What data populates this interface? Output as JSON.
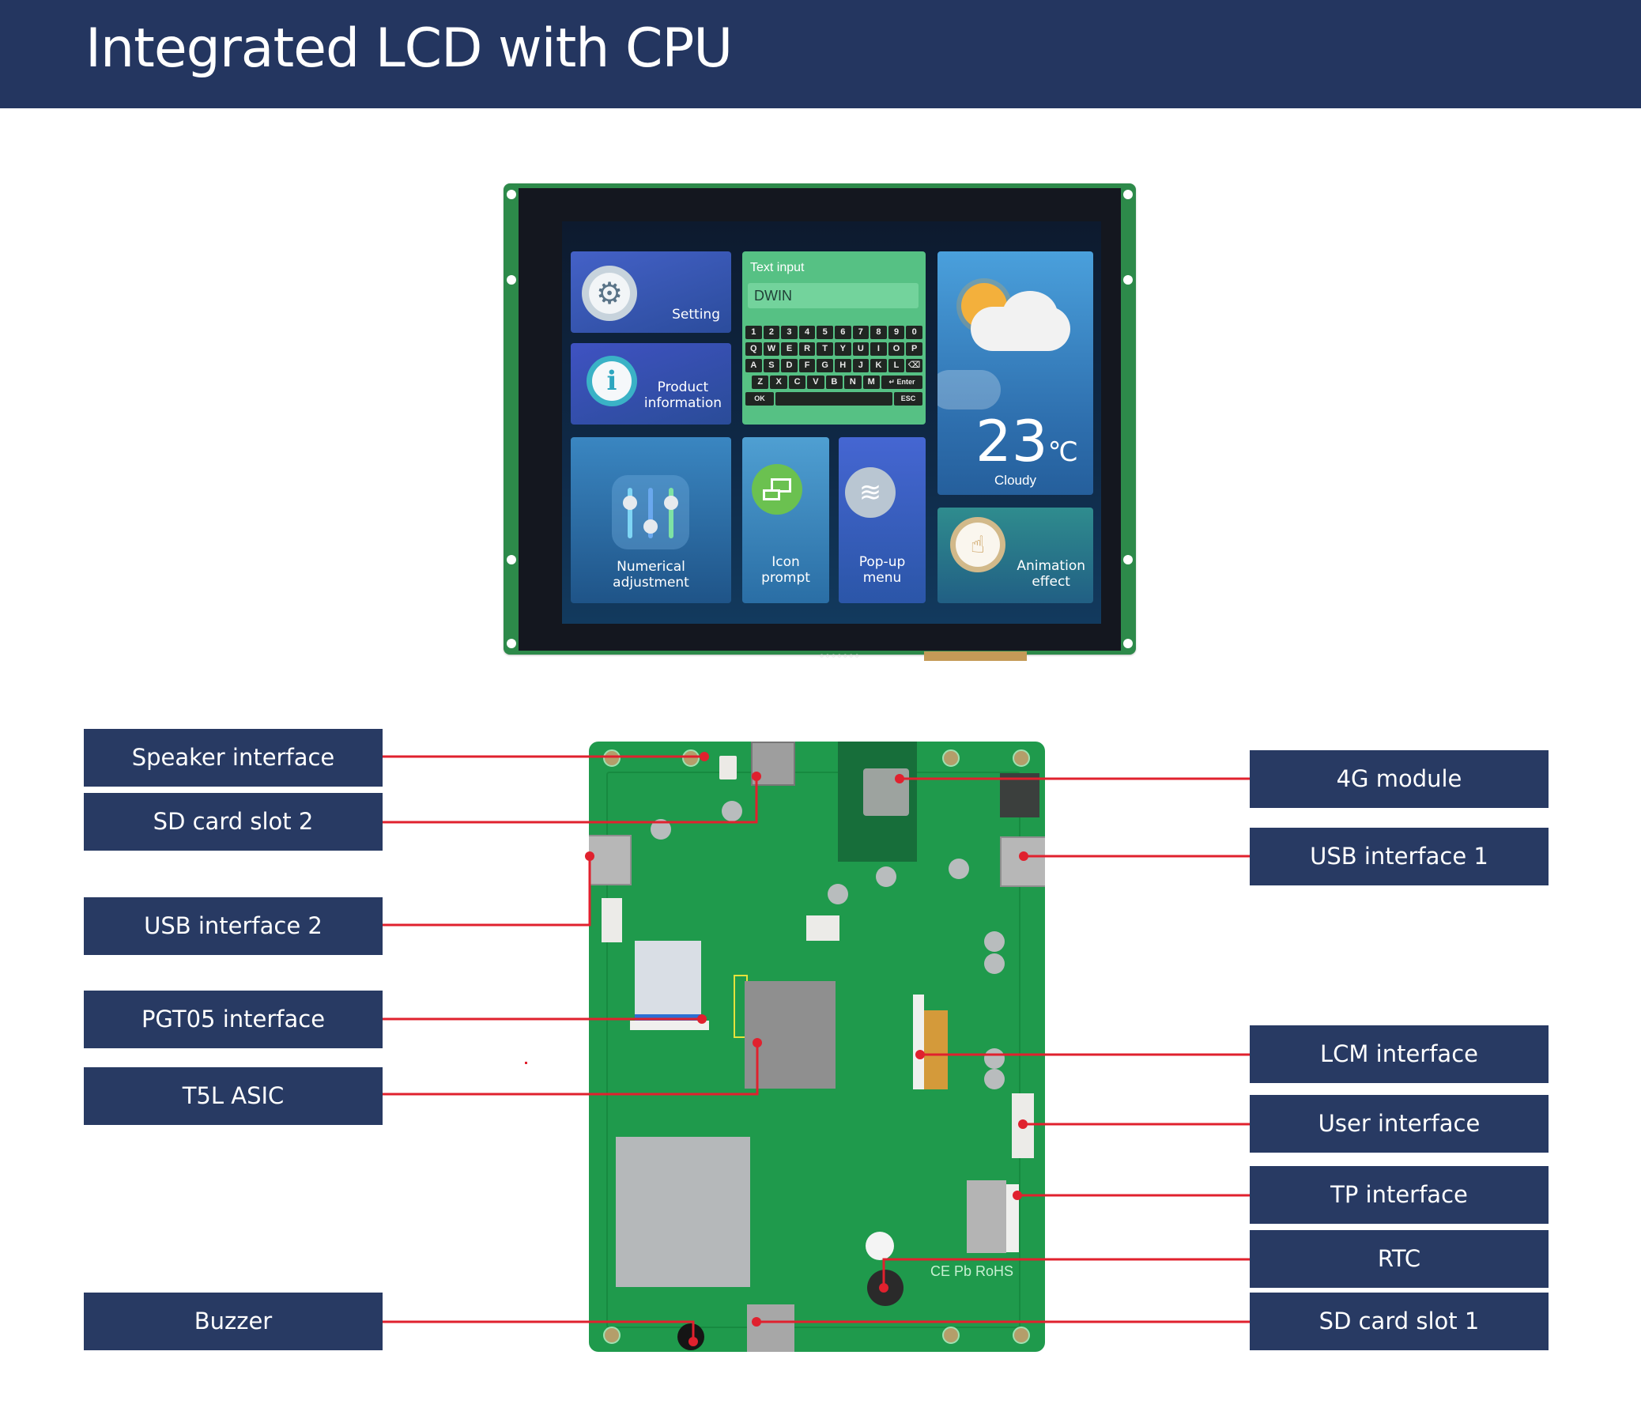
{
  "header": {
    "title": "Integrated LCD with CPU"
  },
  "screen": {
    "tiles": {
      "setting": "Setting",
      "product_line1": "Product",
      "product_line2": "information",
      "text_input_title": "Text input",
      "text_input_value": "DWIN",
      "numerical_line1": "Numerical",
      "numerical_line2": "adjustment",
      "icon_line1": "Icon",
      "icon_line2": "prompt",
      "popup_line1": "Pop-up",
      "popup_line2": "menu",
      "animation_line1": "Animation",
      "animation_line2": "effect"
    },
    "weather": {
      "temperature": "23",
      "unit": "℃",
      "condition": "Cloudy"
    },
    "keyboard": {
      "row1": [
        "1",
        "2",
        "3",
        "4",
        "5",
        "6",
        "7",
        "8",
        "9",
        "0"
      ],
      "row2": [
        "Q",
        "W",
        "E",
        "R",
        "T",
        "Y",
        "U",
        "I",
        "O",
        "P"
      ],
      "row3": [
        "A",
        "S",
        "D",
        "F",
        "G",
        "H",
        "J",
        "K",
        "L",
        "⌫"
      ],
      "row4": [
        "Z",
        "X",
        "C",
        "V",
        "B",
        "N",
        "M",
        "↵ Enter"
      ],
      "ok": "OK",
      "esc": "ESC"
    }
  },
  "pcb": {
    "marks": "CE Pb RoHS"
  },
  "labels": {
    "left": [
      {
        "id": "speaker",
        "text": "Speaker interface"
      },
      {
        "id": "sd2",
        "text": "SD card slot 2"
      },
      {
        "id": "usb2",
        "text": "USB interface 2"
      },
      {
        "id": "pgt05",
        "text": "PGT05 interface"
      },
      {
        "id": "t5l",
        "text": "T5L ASIC"
      },
      {
        "id": "buzzer",
        "text": "Buzzer"
      }
    ],
    "right": [
      {
        "id": "4g",
        "text": "4G module"
      },
      {
        "id": "usb1",
        "text": "USB interface 1"
      },
      {
        "id": "lcm",
        "text": "LCM interface"
      },
      {
        "id": "user",
        "text": "User interface"
      },
      {
        "id": "tp",
        "text": "TP interface"
      },
      {
        "id": "rtc",
        "text": "RTC"
      },
      {
        "id": "sd1",
        "text": "SD card slot 1"
      }
    ]
  },
  "colors": {
    "header_bg": "#243660",
    "label_bg": "#283a63",
    "leader": "#e0212e",
    "pcb": "#1f9a4c"
  }
}
